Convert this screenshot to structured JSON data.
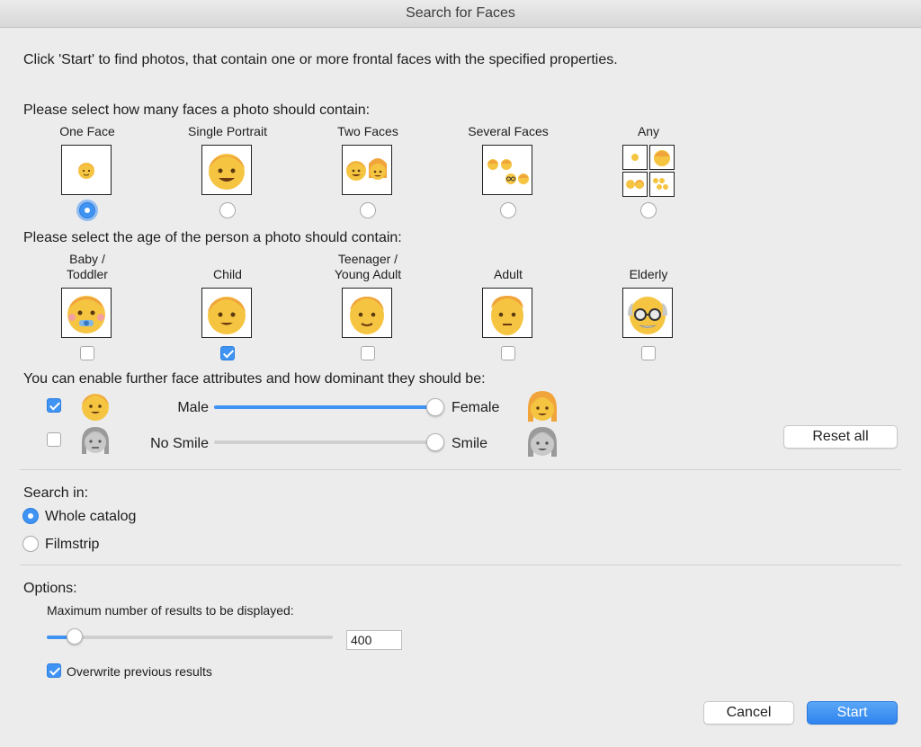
{
  "window": {
    "title": "Search for Faces"
  },
  "intro": "Click 'Start' to find photos, that contain one or more frontal faces with the specified properties.",
  "face_count": {
    "prompt": "Please select how many faces a photo should contain:",
    "options": [
      {
        "label": "One Face",
        "icon": "single-small-face-icon",
        "selected": true
      },
      {
        "label": "Single Portrait",
        "icon": "portrait-face-icon",
        "selected": false
      },
      {
        "label": "Two Faces",
        "icon": "two-faces-icon",
        "selected": false
      },
      {
        "label": "Several Faces",
        "icon": "several-faces-icon",
        "selected": false
      },
      {
        "label": "Any",
        "icon": "any-faces-grid-icon",
        "selected": false
      }
    ]
  },
  "age": {
    "prompt": "Please select the age of the person a photo should contain:",
    "options": [
      {
        "label_line1": "Baby /",
        "label_line2": "Toddler",
        "icon": "baby-face-icon",
        "checked": false
      },
      {
        "label_line1": "",
        "label_line2": "Child",
        "icon": "child-face-icon",
        "checked": true
      },
      {
        "label_line1": "Teenager /",
        "label_line2": "Young Adult",
        "icon": "teen-face-icon",
        "checked": false
      },
      {
        "label_line1": "",
        "label_line2": "Adult",
        "icon": "adult-face-icon",
        "checked": false
      },
      {
        "label_line1": "",
        "label_line2": "Elderly",
        "icon": "elderly-face-icon",
        "checked": false
      }
    ]
  },
  "attributes": {
    "prompt": "You can enable further face attributes and how dominant they should be:",
    "gender": {
      "enabled": true,
      "left": "Male",
      "right": "Female",
      "value": 1.0
    },
    "smile": {
      "enabled": false,
      "left": "No Smile",
      "right": "Smile",
      "value": 1.0
    },
    "reset_label": "Reset all"
  },
  "search_in": {
    "label": "Search in:",
    "options": [
      {
        "label": "Whole catalog",
        "selected": true
      },
      {
        "label": "Filmstrip",
        "selected": false
      }
    ]
  },
  "options": {
    "label": "Options:",
    "max_results_label": "Maximum number of results to be displayed:",
    "max_results_value": "400",
    "max_results_slider": 0.1,
    "overwrite_label": "Overwrite previous results",
    "overwrite_checked": true
  },
  "buttons": {
    "cancel": "Cancel",
    "start": "Start"
  },
  "colors": {
    "accent": "#3f93f2",
    "face": "#f5c542",
    "hair": "#f0a43a"
  }
}
